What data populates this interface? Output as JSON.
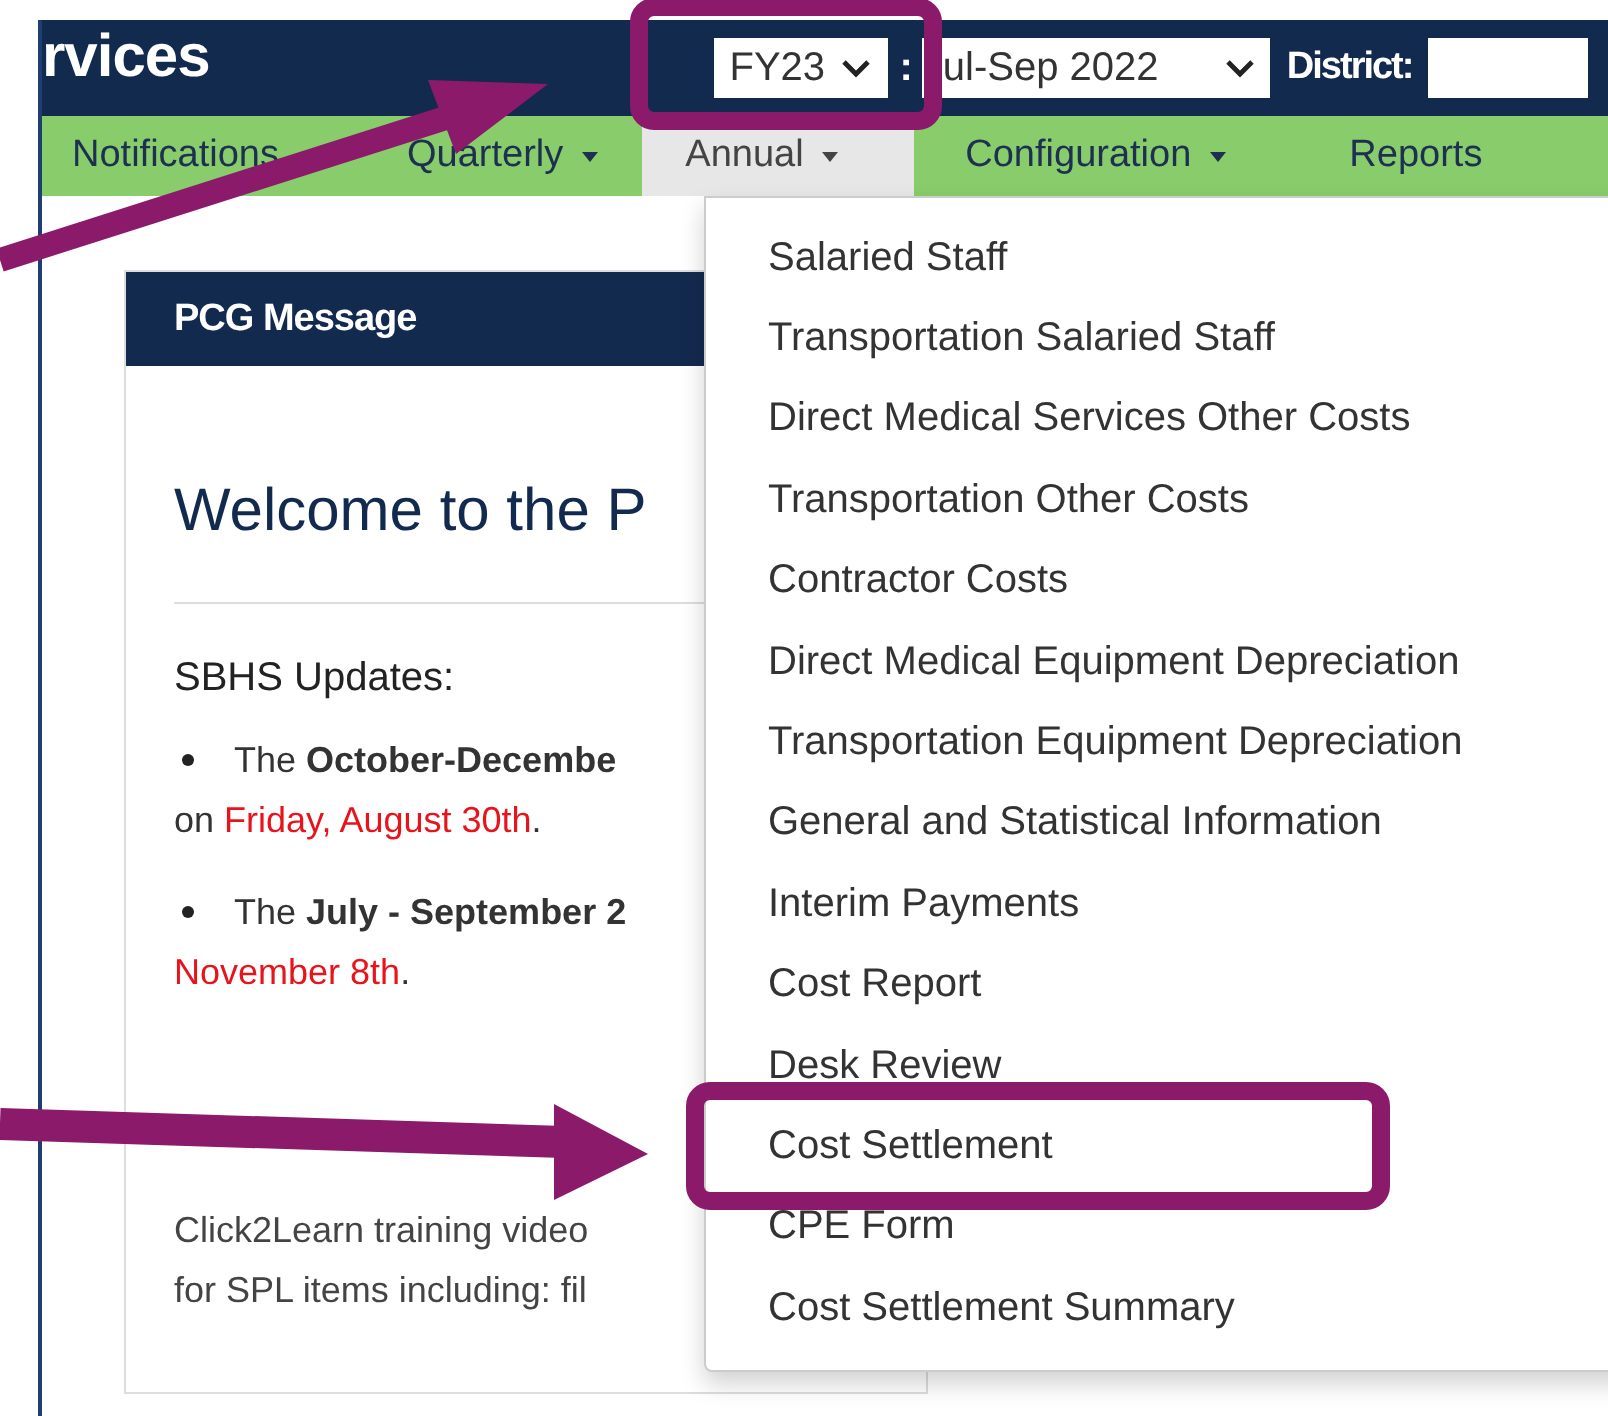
{
  "header": {
    "title": "rvices",
    "fiscal_year": {
      "value": "FY23",
      "highlighted": true
    },
    "separator": ":",
    "quarter": {
      "value": "ul-Sep 2022"
    },
    "district_label": "District:"
  },
  "nav": [
    {
      "label": "Notifications",
      "caret": false,
      "selected": false
    },
    {
      "label": "Quarterly",
      "caret": true,
      "selected": false
    },
    {
      "label": "Annual",
      "caret": true,
      "selected": true
    },
    {
      "label": "Configuration",
      "caret": true,
      "selected": false
    },
    {
      "label": "Reports",
      "caret": false,
      "selected": false
    }
  ],
  "panel": {
    "title": "PCG Message",
    "heading": "Welcome to the P",
    "subheading": "SBHS Updates:",
    "bullets": [
      {
        "lines": [
          [
            {
              "text": "The ",
              "kind": "plain"
            },
            {
              "text": "October-Decembe",
              "kind": "bold"
            }
          ],
          [
            {
              "text": "on ",
              "kind": "plain"
            },
            {
              "text": "Friday, August 30th",
              "kind": "red"
            },
            {
              "text": ".",
              "kind": "plain"
            }
          ]
        ]
      },
      {
        "lines": [
          [
            {
              "text": "The ",
              "kind": "plain"
            },
            {
              "text": "July - September 2",
              "kind": "bold"
            }
          ],
          [
            {
              "text": "November 8th",
              "kind": "red"
            },
            {
              "text": ".",
              "kind": "plain"
            }
          ]
        ]
      }
    ],
    "footer_lines": [
      "Click2Learn training video",
      "for SPL items including: fil"
    ]
  },
  "menu": [
    {
      "label": "Salaried Staff",
      "highlighted": false
    },
    {
      "label": "Transportation Salaried Staff",
      "highlighted": false
    },
    {
      "label": "Direct Medical Services Other Costs",
      "highlighted": false
    },
    {
      "label": "Transportation Other Costs",
      "highlighted": false
    },
    {
      "label": "Contractor Costs",
      "highlighted": false
    },
    {
      "label": "Direct Medical Equipment Depreciation",
      "highlighted": false
    },
    {
      "label": "Transportation Equipment Depreciation",
      "highlighted": false
    },
    {
      "label": "General and Statistical Information",
      "highlighted": false
    },
    {
      "label": "Interim Payments",
      "highlighted": false
    },
    {
      "label": "Cost Report",
      "highlighted": false
    },
    {
      "label": "Desk Review",
      "highlighted": false
    },
    {
      "label": "Cost Settlement",
      "highlighted": true
    },
    {
      "label": "CPE Form",
      "highlighted": false
    },
    {
      "label": "Cost Settlement Summary",
      "highlighted": false
    }
  ]
}
